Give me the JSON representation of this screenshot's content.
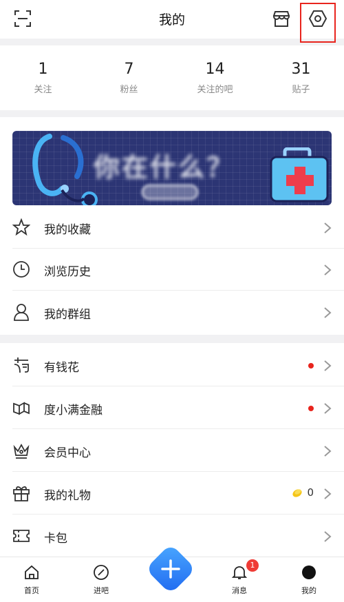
{
  "header": {
    "title": "我的"
  },
  "stats": [
    {
      "num": "1",
      "label": "关注"
    },
    {
      "num": "7",
      "label": "粉丝"
    },
    {
      "num": "14",
      "label": "关注的吧"
    },
    {
      "num": "31",
      "label": "贴子"
    }
  ],
  "menu1": [
    {
      "label": "我的收藏",
      "icon": "star-icon"
    },
    {
      "label": "浏览历史",
      "icon": "clock-icon"
    },
    {
      "label": "我的群组",
      "icon": "user-icon"
    }
  ],
  "menu2": [
    {
      "label": "有钱花",
      "icon": "money-icon"
    },
    {
      "label": "度小满金融",
      "icon": "finance-icon"
    },
    {
      "label": "会员中心",
      "icon": "crown-icon"
    },
    {
      "label": "我的礼物",
      "icon": "gift-icon"
    },
    {
      "label": "卡包",
      "icon": "ticket-icon"
    }
  ],
  "gifts": {
    "coins": "0"
  },
  "tabbar": {
    "home": "首页",
    "enter_bar": "进吧",
    "messages": "消息",
    "messages_badge": "1",
    "mine": "我的"
  },
  "colors": {
    "accent": "#2e7cf6",
    "alert": "#e8241d",
    "highlight_box": "#e8241d"
  }
}
